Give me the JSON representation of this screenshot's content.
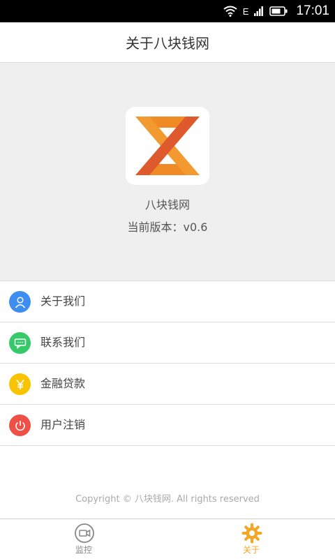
{
  "status_bar": {
    "network": "E",
    "time": "17:01"
  },
  "header": {
    "title": "关于八块钱网"
  },
  "hero": {
    "app_name": "八块钱网",
    "version_text": "当前版本：v0.6"
  },
  "menu": {
    "items": [
      {
        "label": "关于我们",
        "icon": "user-icon",
        "color": "#3d8ef0"
      },
      {
        "label": "联系我们",
        "icon": "chat-icon",
        "color": "#36c96a"
      },
      {
        "label": "金融贷款",
        "icon": "yen-icon",
        "color": "#f9c300"
      },
      {
        "label": "用户注销",
        "icon": "power-icon",
        "color": "#ee5045"
      }
    ]
  },
  "footer": {
    "copyright": "Copyright © 八块钱网. All rights reserved"
  },
  "tabs": [
    {
      "label": "监控",
      "icon": "camera-icon",
      "active": false
    },
    {
      "label": "关于",
      "icon": "gear-icon",
      "active": true
    }
  ],
  "colors": {
    "accent": "#f5a623",
    "inactive": "#888888",
    "logo_orange": "#f08a24",
    "logo_red": "#de5a2c"
  }
}
